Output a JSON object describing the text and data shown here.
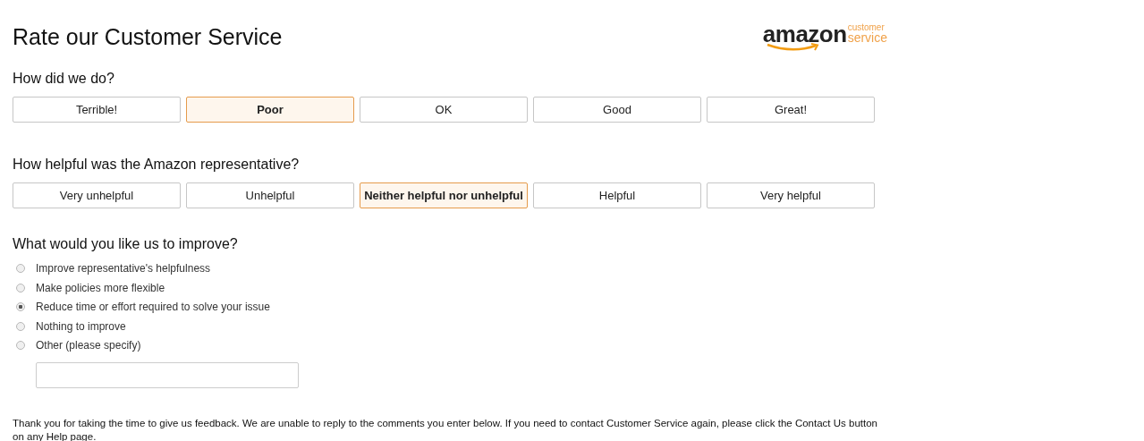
{
  "title": "Rate our Customer Service",
  "logo": {
    "brand": "amazon",
    "line_1": "customer",
    "line_2": "service"
  },
  "questions": [
    {
      "prompt": "How did we do?",
      "options": [
        {
          "label": "Terrible!",
          "selected": false
        },
        {
          "label": "Poor",
          "selected": true
        },
        {
          "label": "OK",
          "selected": false
        },
        {
          "label": "Good",
          "selected": false
        },
        {
          "label": "Great!",
          "selected": false
        }
      ]
    },
    {
      "prompt": "How helpful was the Amazon representative?",
      "options": [
        {
          "label": "Very unhelpful",
          "selected": false
        },
        {
          "label": "Unhelpful",
          "selected": false
        },
        {
          "label": "Neither helpful nor unhelpful",
          "selected": true
        },
        {
          "label": "Helpful",
          "selected": false
        },
        {
          "label": "Very helpful",
          "selected": false
        }
      ]
    }
  ],
  "improve": {
    "prompt": "What would you like us to improve?",
    "choices": [
      {
        "label": "Improve representative's helpfulness",
        "selected": false
      },
      {
        "label": "Make policies more flexible",
        "selected": false
      },
      {
        "label": "Reduce time or effort required to solve your issue",
        "selected": true
      },
      {
        "label": "Nothing to improve",
        "selected": false
      },
      {
        "label": "Other (please specify)",
        "selected": false
      }
    ]
  },
  "footer_note": "Thank you for taking the time to give us feedback. We are unable to reply to the comments you enter below. If you need to contact Customer Service again, please click the Contact Us button on any Help page."
}
